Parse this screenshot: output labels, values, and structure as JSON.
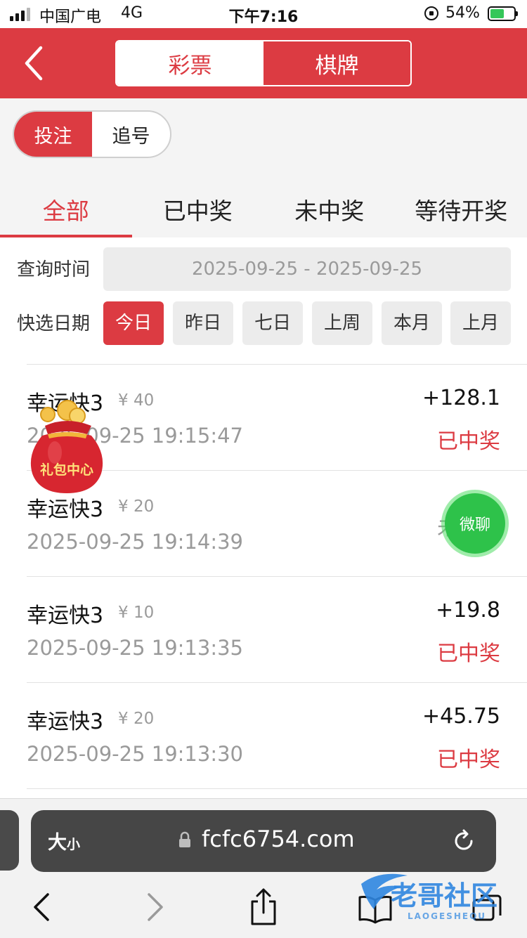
{
  "status_bar": {
    "carrier": "中国广电",
    "network": "4G",
    "time": "下午7:16",
    "battery_percent": "54%",
    "battery_level": 0.54
  },
  "header": {
    "segments": [
      {
        "label": "彩票",
        "active": true
      },
      {
        "label": "棋牌",
        "active": false
      }
    ]
  },
  "mode_toggle": [
    {
      "label": "投注",
      "active": true
    },
    {
      "label": "追号",
      "active": false
    }
  ],
  "tabs": [
    {
      "label": "全部",
      "active": true
    },
    {
      "label": "已中奖",
      "active": false
    },
    {
      "label": "未中奖",
      "active": false
    },
    {
      "label": "等待开奖",
      "active": false
    }
  ],
  "query": {
    "time_label": "查询时间",
    "date_range": "2025-09-25 - 2025-09-25",
    "quick_label": "快选日期",
    "quick_options": [
      {
        "label": "今日",
        "active": true
      },
      {
        "label": "昨日",
        "active": false
      },
      {
        "label": "七日",
        "active": false
      },
      {
        "label": "上周",
        "active": false
      },
      {
        "label": "本月",
        "active": false
      },
      {
        "label": "上月",
        "active": false
      }
    ]
  },
  "records": [
    {
      "game": "幸运快3",
      "amount": "¥ 40",
      "time": "2025-09-25 19:15:47",
      "win": "+128.1",
      "status": "已中奖"
    },
    {
      "game": "幸运快3",
      "amount": "¥ 20",
      "time": "2025-09-25 19:14:39",
      "win": "",
      "status": "未中奖"
    },
    {
      "game": "幸运快3",
      "amount": "¥ 10",
      "time": "2025-09-25 19:13:35",
      "win": "+19.8",
      "status": "已中奖"
    },
    {
      "game": "幸运快3",
      "amount": "¥ 20",
      "time": "2025-09-25 19:13:30",
      "win": "+45.75",
      "status": "已中奖"
    }
  ],
  "floating": {
    "gift_label": "礼包中心",
    "chat_label": "微聊"
  },
  "browser": {
    "text_size_label": "大",
    "text_size_small": "小",
    "url": "fcfc6754.com"
  },
  "watermark": {
    "text": "老哥社区",
    "subtext": "LAOGESHEQU"
  },
  "colors": {
    "brand_red": "#dc3b42",
    "chat_green": "#2ec24a"
  }
}
